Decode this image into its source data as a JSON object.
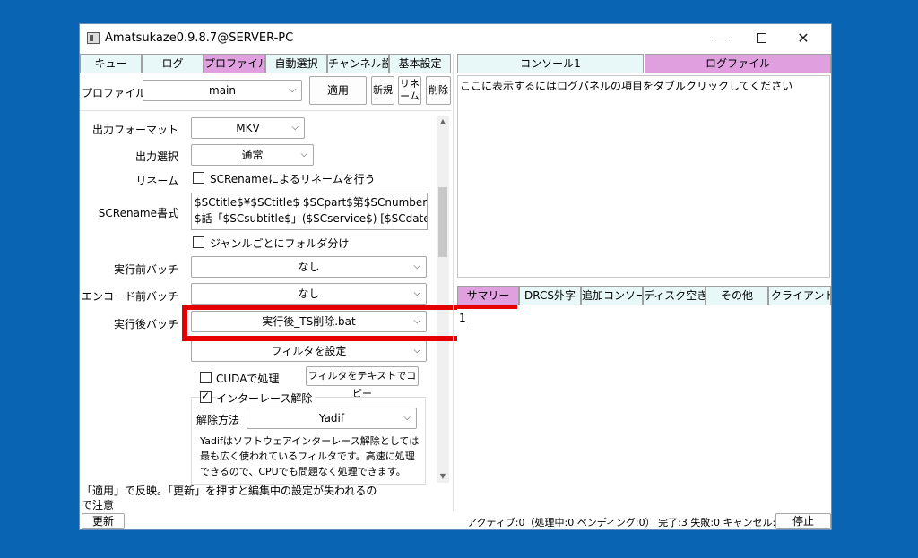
{
  "window": {
    "title": "Amatsukaze0.9.8.7@SERVER-PC",
    "minimize_glyph": "",
    "maximize_glyph": "",
    "close_glyph": "✕"
  },
  "left_tabs": [
    {
      "label": "キュー",
      "active": false
    },
    {
      "label": "ログ",
      "active": false
    },
    {
      "label": "プロファイル",
      "active": true
    },
    {
      "label": "自動選択",
      "active": false
    },
    {
      "label": "チャンネル設",
      "active": false
    },
    {
      "label": "基本設定",
      "active": false
    }
  ],
  "right_tabs": [
    {
      "label": "コンソール1",
      "active": false
    },
    {
      "label": "ログファイル",
      "active": true
    }
  ],
  "bottom_tabs": [
    {
      "label": "サマリー",
      "active": true
    },
    {
      "label": "DRCS外字",
      "active": false
    },
    {
      "label": "追加コンソー",
      "active": false
    },
    {
      "label": "ディスク空き",
      "active": false
    },
    {
      "label": "その他",
      "active": false
    },
    {
      "label": "クライアントロ",
      "active": false
    }
  ],
  "profile": {
    "label": "プロファイル",
    "value": "main",
    "apply_button": "適用",
    "new_button": "新規",
    "rename_button_line1": "リネ",
    "rename_button_line2": "ーム",
    "delete_button": "削除"
  },
  "settings": {
    "output_format_label": "出力フォーマット",
    "output_format_value": "MKV",
    "output_select_label": "出力選択",
    "output_select_value": "通常",
    "rename_label": "リネーム",
    "rename_checkbox": "SCRenameによるリネームを行う",
    "rename_checked": false,
    "screname_label": "SCRename書式",
    "screname_line1": "$SCtitle$¥$SCtitle$ $SCpart$第$SCnumber",
    "screname_line2": "$話「$SCsubtitle$」($SCservice$) [$SCdate$]",
    "genre_checkbox": "ジャンルごとにフォルダ分け",
    "genre_checked": false,
    "pre_batch_label": "実行前バッチ",
    "pre_batch_value": "なし",
    "encode_batch_label": "エンコード前バッチ",
    "encode_batch_value": "なし",
    "post_batch_label": "実行後バッチ",
    "post_batch_value": "実行後_TS削除.bat",
    "filter_select": "フィルタを設定",
    "cuda_checkbox": "CUDAで処理",
    "cuda_checked": false,
    "copy_filter_button": "フィルタをテキストでコピー",
    "deinterlace_checkbox": "インターレース解除",
    "deinterlace_checked": true,
    "deinterlace_method_label": "解除方法",
    "deinterlace_method_value": "Yadif",
    "deinterlace_desc": "Yadifはソフトウェアインターレース解除としては最も広く使われているフィルタです。高速に処理できるので、CPUでも問題なく処理できます。"
  },
  "notice": "「適用」で反映。「更新」を押すと編集中の設定が失われるので注意",
  "log_hint": "ここに表示するにはログパネルの項目をダブルクリックしてください",
  "summary_line": "1",
  "status": {
    "refresh_button": "更新",
    "status_text": "アクティブ:0（処理中:0 ペンディング:0） 完了:3 失敗:0 キャンセル:0",
    "stop_button": "停止"
  },
  "colors": {
    "desktop": "#0a64b4",
    "active_tab": "#e0a0e0",
    "tab": "#e8f8f8",
    "highlight": "#e50000"
  }
}
